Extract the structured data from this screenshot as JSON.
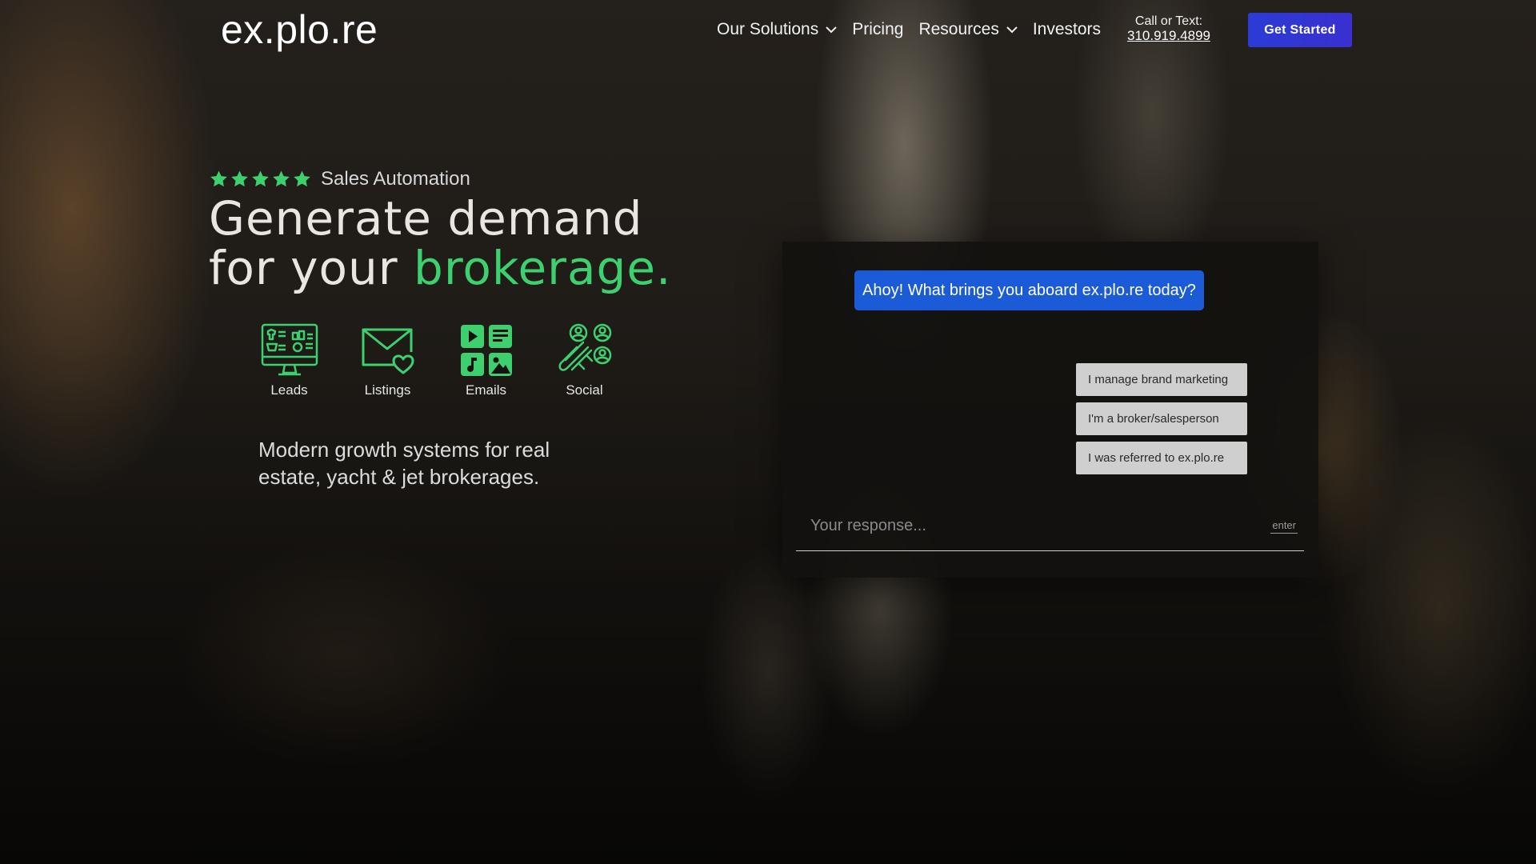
{
  "brand": {
    "logo": "ex.plo.re"
  },
  "nav": {
    "items": [
      {
        "label": "Our Solutions",
        "has_dropdown": true
      },
      {
        "label": "Pricing",
        "has_dropdown": false
      },
      {
        "label": "Resources",
        "has_dropdown": true
      },
      {
        "label": "Investors",
        "has_dropdown": false
      }
    ],
    "call_label": "Call or Text:",
    "call_number": "310.919.4899",
    "cta_label": "Get Started"
  },
  "hero": {
    "rating_stars": 5,
    "rating_label": "Sales Automation",
    "headline_line1": "Generate demand",
    "headline_line2_prefix": "for your ",
    "headline_line2_accent": "brokerage.",
    "features": [
      {
        "label": "Leads",
        "icon": "monitor-dashboard-icon"
      },
      {
        "label": "Listings",
        "icon": "envelope-heart-icon"
      },
      {
        "label": "Emails",
        "icon": "content-grid-icon"
      },
      {
        "label": "Social",
        "icon": "magnet-users-icon"
      }
    ],
    "tagline": "Modern growth systems for real estate, yacht & jet brokerages."
  },
  "chat": {
    "bot_message": "Ahoy! What brings you aboard ex.plo.re today?",
    "options": [
      "I manage brand marketing",
      "I'm a broker/salesperson",
      "I was referred to ex.plo.re"
    ],
    "input_placeholder": "Your response...",
    "enter_hint": "enter"
  },
  "colors": {
    "accent_green": "#3ecf6e",
    "cta_blue": "#2b3cd6",
    "bubble_blue": "#1b5bd8",
    "option_gray": "#cfcfcf"
  }
}
